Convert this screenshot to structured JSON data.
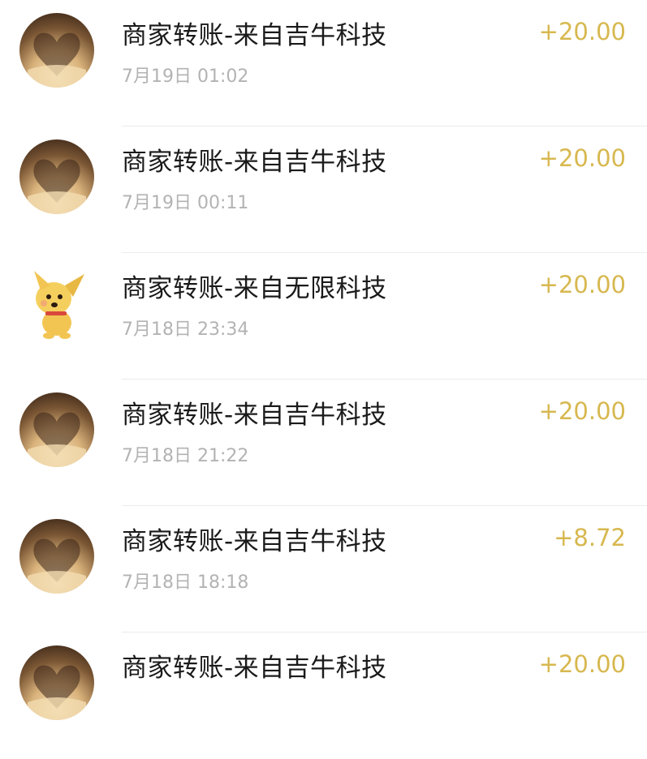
{
  "transactions": [
    {
      "title": "商家转账-来自吉牛科技",
      "time": "7月19日 01:02",
      "amount": "+20.00",
      "avatar": "book-heart-avatar"
    },
    {
      "title": "商家转账-来自吉牛科技",
      "time": "7月19日 00:11",
      "amount": "+20.00",
      "avatar": "book-heart-avatar"
    },
    {
      "title": "商家转账-来自无限科技",
      "time": "7月18日 23:34",
      "amount": "+20.00",
      "avatar": "cartoon-dog-avatar"
    },
    {
      "title": "商家转账-来自吉牛科技",
      "time": "7月18日 21:22",
      "amount": "+20.00",
      "avatar": "book-heart-avatar"
    },
    {
      "title": "商家转账-来自吉牛科技",
      "time": "7月18日 18:18",
      "amount": "+8.72",
      "avatar": "book-heart-avatar"
    },
    {
      "title": "商家转账-来自吉牛科技",
      "time": "",
      "amount": "+20.00",
      "avatar": "book-heart-avatar"
    }
  ],
  "colors": {
    "amount": "#d7b84f",
    "title": "#1a1a1a",
    "time": "#b3b3b3",
    "divider": "#ececec"
  }
}
